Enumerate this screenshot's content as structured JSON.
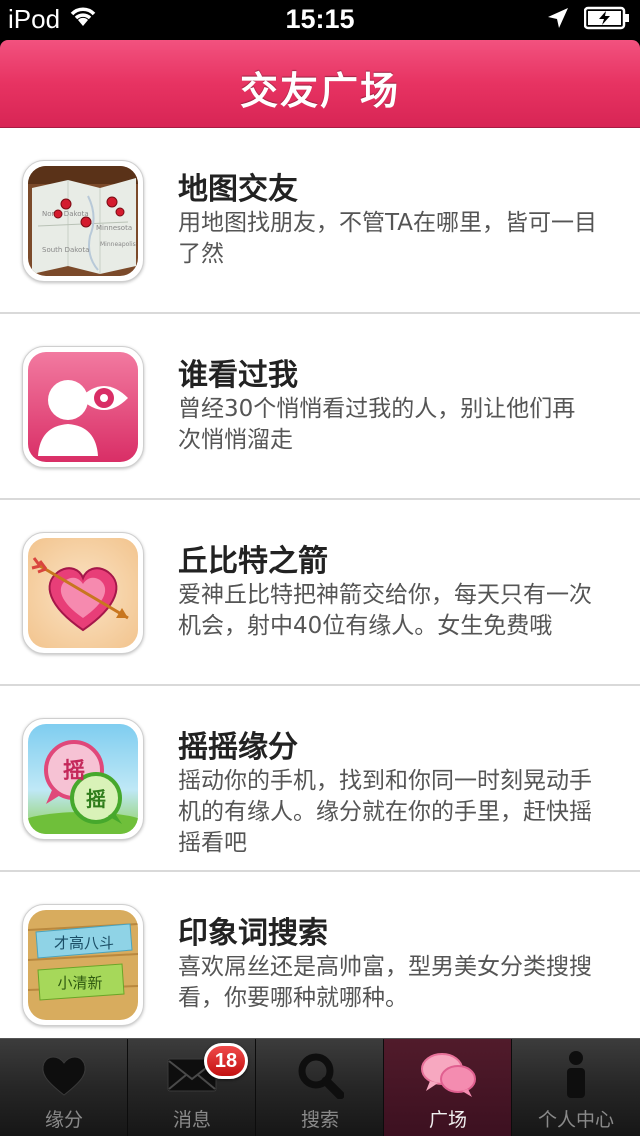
{
  "status_bar": {
    "carrier": "iPod",
    "time": "15:15",
    "icons": [
      "wifi-icon",
      "location-arrow-icon",
      "battery-charging-icon"
    ]
  },
  "navbar": {
    "title": "交友广场"
  },
  "list": [
    {
      "title": "地图交友",
      "desc": "用地图找朋友，不管TA在哪里，皆可一目了然",
      "icon": "map-icon",
      "map_labels": [
        "North Dakota",
        "Minnesota",
        "South Dakota",
        "Minneapolis"
      ]
    },
    {
      "title": "谁看过我",
      "desc": "曾经30个悄悄看过我的人，别让他们再次悄悄溜走",
      "icon": "visitor-eye-icon"
    },
    {
      "title": "丘比特之箭",
      "desc": "爱神丘比特把神箭交给你，每天只有一次机会，射中40位有缘人。女生免费哦",
      "icon": "cupid-heart-arrow-icon"
    },
    {
      "title": "摇摇缘分",
      "desc": "摇动你的手机，找到和你同一时刻晃动手机的有缘人。缘分就在你的手里，赶快摇摇看吧",
      "icon": "shake-bubbles-icon",
      "icon_text": [
        "摇",
        "摇"
      ]
    },
    {
      "title": "印象词搜索",
      "desc": "喜欢屌丝还是高帅富，型男美女分类搜搜看，你要哪种就哪种。",
      "icon": "tag-search-icon",
      "icon_text": [
        "才高八斗",
        "小清新"
      ]
    }
  ],
  "tabbar": {
    "active_index": 3,
    "tabs": [
      {
        "label": "缘分",
        "icon": "heart-icon"
      },
      {
        "label": "消息",
        "icon": "envelope-icon",
        "badge": "18"
      },
      {
        "label": "搜索",
        "icon": "magnifier-icon"
      },
      {
        "label": "广场",
        "icon": "chat-bubbles-icon"
      },
      {
        "label": "个人中心",
        "icon": "person-icon"
      }
    ]
  },
  "colors": {
    "nav_pink": "#e73362",
    "badge_red": "#d21a1a",
    "tab_active": "#4a1727"
  }
}
